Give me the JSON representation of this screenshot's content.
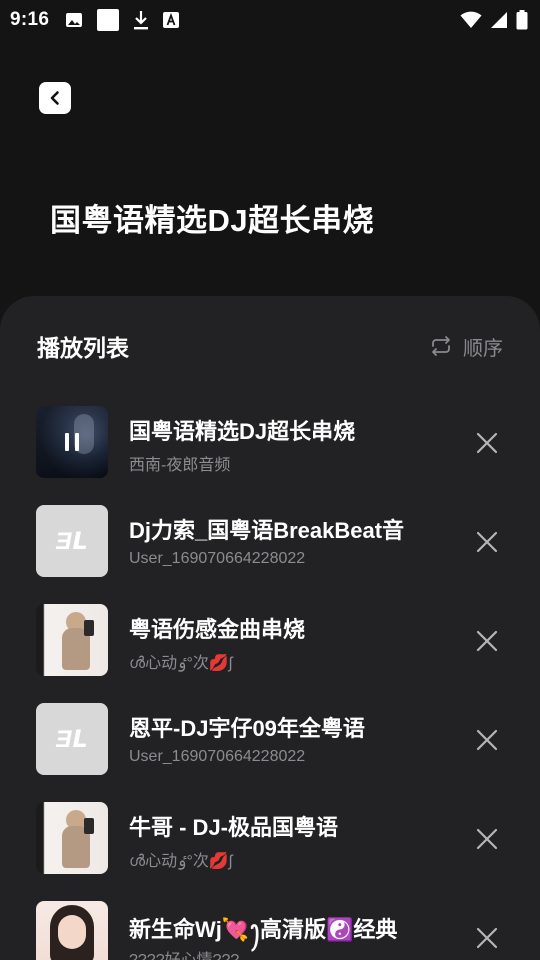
{
  "status_bar": {
    "time": "9:16",
    "left_icons": [
      "image-icon",
      "square-icon",
      "download-icon",
      "translate-icon"
    ],
    "right_icons": [
      "wifi-icon",
      "signal-icon",
      "battery-icon"
    ]
  },
  "header": {
    "back_icon": "chevron-left-icon",
    "title": "国粤语精选DJ超长串烧"
  },
  "playlist_sheet": {
    "title": "播放列表",
    "order_label": "顺序",
    "order_icon": "repeat-icon",
    "tracks": [
      {
        "title": " 国粤语精选DJ超长串烧",
        "artist": "西南-夜郎音频",
        "cover": "dark-photo",
        "playing": true
      },
      {
        "title": "Dj力索_国粤语BreakBeat音",
        "artist": "User_169070664228022",
        "cover": "dj-logo"
      },
      {
        "title": "粤语伤感金曲串烧",
        "artist": "ൾ心动ٶ°次💋ʃ",
        "cover": "girl-photo"
      },
      {
        "title": "恩平-DJ宇仔09年全粤语",
        "artist": "User_169070664228022",
        "cover": "dj-logo"
      },
      {
        "title": "牛哥 - DJ-极品国粤语",
        "artist": "ൾ心动ٶ°次💋ʃ",
        "cover": "girl-photo"
      },
      {
        "title": "新生命Wj💘ꫂ高清版☯️经典",
        "artist": "????好心情???",
        "cover": "portrait-photo"
      }
    ]
  },
  "colors": {
    "background": "#141414",
    "sheet": "#222224",
    "secondary_text": "#8c8c90"
  }
}
